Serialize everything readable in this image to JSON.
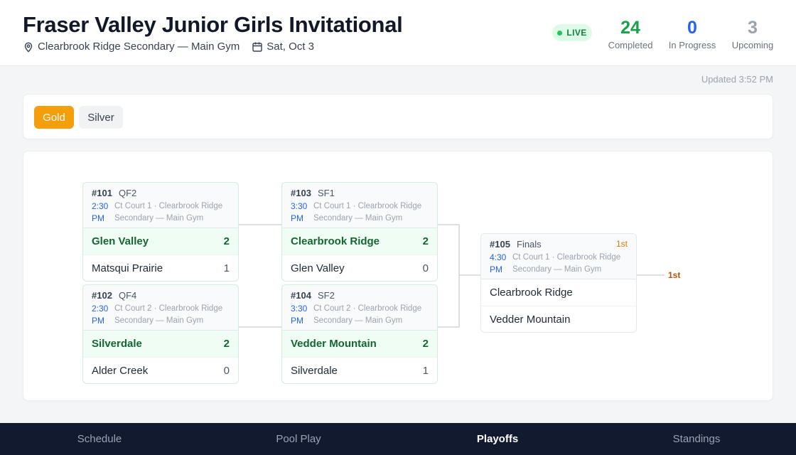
{
  "header": {
    "title": "Fraser Valley Junior Girls Invitational",
    "venue": "Clearbrook Ridge Secondary — Main Gym",
    "date": "Sat, Oct 3",
    "live_label": "LIVE",
    "stats": [
      {
        "value": "24",
        "label": "Completed",
        "color": "#16a34a"
      },
      {
        "value": "0",
        "label": "In Progress",
        "color": "#2563eb"
      },
      {
        "value": "3",
        "label": "Upcoming",
        "color": "#9ca3af"
      }
    ]
  },
  "updated": "Updated 3:52 PM",
  "divisions": [
    "Gold",
    "Silver"
  ],
  "selected_division": "Gold",
  "matches": {
    "m101": {
      "num": "#101",
      "round": "QF2",
      "time": "2:30 PM",
      "location": "Ct Court 1 · Clearbrook Ridge Secondary — Main Gym",
      "teams": [
        {
          "name": "Glen Valley",
          "score": "2",
          "winner": true
        },
        {
          "name": "Matsqui Prairie",
          "score": "1",
          "winner": false
        }
      ]
    },
    "m102": {
      "num": "#102",
      "round": "QF4",
      "time": "2:30 PM",
      "location": "Ct Court 2 · Clearbrook Ridge Secondary — Main Gym",
      "teams": [
        {
          "name": "Silverdale",
          "score": "2",
          "winner": true
        },
        {
          "name": "Alder Creek",
          "score": "0",
          "winner": false
        }
      ]
    },
    "m103": {
      "num": "#103",
      "round": "SF1",
      "time": "3:30 PM",
      "location": "Ct Court 1 · Clearbrook Ridge Secondary — Main Gym",
      "teams": [
        {
          "name": "Clearbrook Ridge",
          "score": "2",
          "winner": true
        },
        {
          "name": "Glen Valley",
          "score": "0",
          "winner": false
        }
      ]
    },
    "m104": {
      "num": "#104",
      "round": "SF2",
      "time": "3:30 PM",
      "location": "Ct Court 2 · Clearbrook Ridge Secondary — Main Gym",
      "teams": [
        {
          "name": "Vedder Mountain",
          "score": "2",
          "winner": true
        },
        {
          "name": "Silverdale",
          "score": "1",
          "winner": false
        }
      ]
    },
    "m105": {
      "num": "#105",
      "round": "Finals",
      "badge": "1st",
      "time": "4:30 PM",
      "location": "Ct Court 1 · Clearbrook Ridge Secondary — Main Gym",
      "teams": [
        {
          "name": "Clearbrook Ridge",
          "score": "",
          "winner": false
        },
        {
          "name": "Vedder Mountain",
          "score": "",
          "winner": false
        }
      ]
    }
  },
  "champion_label": "1st",
  "nav": {
    "items": [
      "Schedule",
      "Pool Play",
      "Playoffs",
      "Standings"
    ],
    "active": "Playoffs"
  }
}
